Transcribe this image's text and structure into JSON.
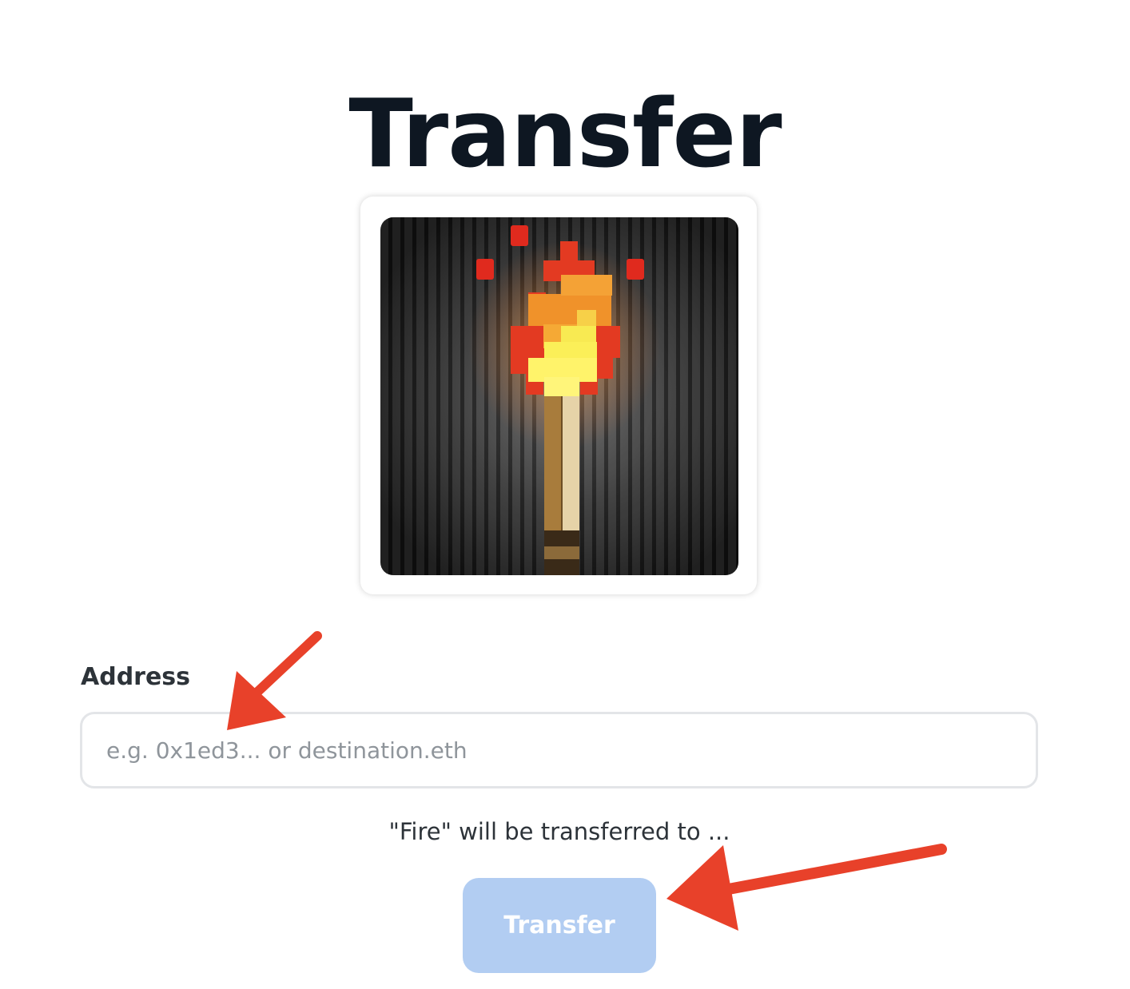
{
  "page": {
    "title": "Transfer"
  },
  "nft": {
    "name": "Fire",
    "image_icon": "pixel-torch-icon"
  },
  "form": {
    "address_label": "Address",
    "address_value": "",
    "address_placeholder": "e.g. 0x1ed3... or destination.eth",
    "transfer_note": "\"Fire\" will be transferred to ...",
    "submit_label": "Transfer",
    "submit_enabled": false
  },
  "annotations": {
    "arrow_color": "#e8412a",
    "targets": [
      "address-input",
      "transfer-button"
    ]
  },
  "colors": {
    "title": "#0e1722",
    "button_disabled": "#b2cdf2",
    "input_border": "#e3e5e8",
    "placeholder": "#8f959b"
  }
}
